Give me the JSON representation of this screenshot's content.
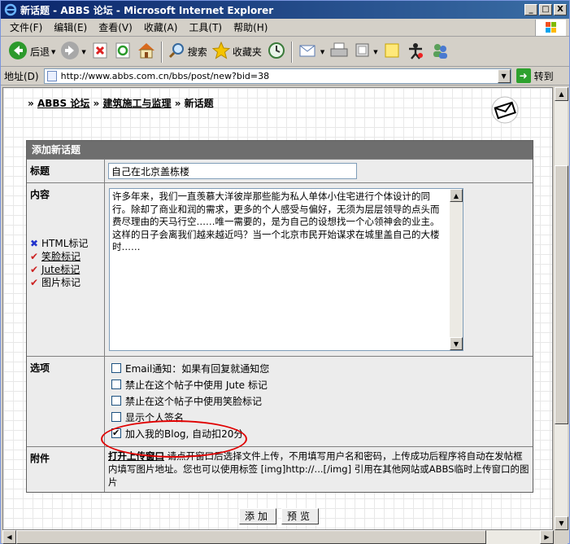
{
  "window": {
    "title": "新话题 - ABBS 论坛 - Microsoft Internet Explorer",
    "minimize": "_",
    "maximize": "□",
    "close": "X"
  },
  "menu": [
    "文件(F)",
    "编辑(E)",
    "查看(V)",
    "收藏(A)",
    "工具(T)",
    "帮助(H)"
  ],
  "toolbar": {
    "back_label": "后退",
    "search_label": "搜索",
    "favorites_label": "收藏夹"
  },
  "address": {
    "label": "地址(D)",
    "url": "http://www.abbs.com.cn/bbs/post/new?bid=38",
    "go_label": "转到"
  },
  "breadcrumb": {
    "prefix": "»",
    "forum": "ABBS 论坛",
    "sep": "»",
    "board": "建筑施工与监理",
    "sep2": "»",
    "current": "新话题"
  },
  "form": {
    "header": "添加新话题",
    "title_label": "标题",
    "title_value": "自己在北京盖栋楼",
    "content_label": "内容",
    "content_value": "许多年来，我们一直羡慕大洋彼岸那些能为私人单体小住宅进行个体设计的同行。除却了商业和润的需求，更多的个人感受与偏好，无须为层层领导的点头而费尽理由的天马行空……唯一需要的，是为自己的设想找一个心领神会的业主。这样的日子会离我们越来越近吗？当一个北京市民开始谋求在城里盖自己的大楼时……",
    "markup": [
      {
        "mark": "✖",
        "type": "x",
        "label": "HTML标记",
        "link": false
      },
      {
        "mark": "✔",
        "type": "v",
        "label": "笑脸标记",
        "link": true
      },
      {
        "mark": "✔",
        "type": "v",
        "label": "Jute标记",
        "link": true
      },
      {
        "mark": "✔",
        "type": "v",
        "label": "图片标记",
        "link": false
      }
    ],
    "options_label": "选项",
    "options": [
      {
        "label": "Email通知：如果有回复就通知您",
        "checked": false
      },
      {
        "label": "禁止在这个帖子中使用  Jute 标记",
        "checked": false
      },
      {
        "label": "禁止在这个帖子中使用笑脸标记",
        "checked": false
      },
      {
        "label": "显示个人签名",
        "checked": false
      },
      {
        "label": "加入我的Blog, 自动扣20分",
        "checked": true
      }
    ],
    "attach_label": "附件",
    "attach_link": "打开上传窗口",
    "attach_text": " 请点开窗口后选择文件上传，不用填写用户名和密码，上传成功后程序将自动在发帖框内填写图片地址。您也可以使用标签 [img]http://...[/img] 引用在其他网站或ABBS临时上传窗口的图片",
    "submit_label": "添加",
    "preview_label": "预览"
  },
  "colors": {
    "title_bar": "#0a246a",
    "form_header": "#6e6e6e",
    "highlight": "#e00000"
  }
}
